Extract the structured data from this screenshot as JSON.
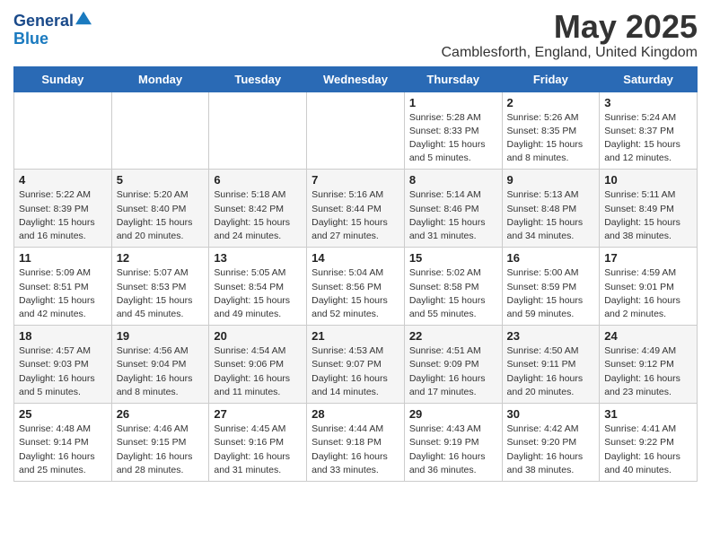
{
  "header": {
    "logo_line1": "General",
    "logo_line2": "Blue",
    "month_title": "May 2025",
    "location": "Camblesforth, England, United Kingdom"
  },
  "days_of_week": [
    "Sunday",
    "Monday",
    "Tuesday",
    "Wednesday",
    "Thursday",
    "Friday",
    "Saturday"
  ],
  "weeks": [
    [
      {
        "day": "",
        "info": ""
      },
      {
        "day": "",
        "info": ""
      },
      {
        "day": "",
        "info": ""
      },
      {
        "day": "",
        "info": ""
      },
      {
        "day": "1",
        "info": "Sunrise: 5:28 AM\nSunset: 8:33 PM\nDaylight: 15 hours\nand 5 minutes."
      },
      {
        "day": "2",
        "info": "Sunrise: 5:26 AM\nSunset: 8:35 PM\nDaylight: 15 hours\nand 8 minutes."
      },
      {
        "day": "3",
        "info": "Sunrise: 5:24 AM\nSunset: 8:37 PM\nDaylight: 15 hours\nand 12 minutes."
      }
    ],
    [
      {
        "day": "4",
        "info": "Sunrise: 5:22 AM\nSunset: 8:39 PM\nDaylight: 15 hours\nand 16 minutes."
      },
      {
        "day": "5",
        "info": "Sunrise: 5:20 AM\nSunset: 8:40 PM\nDaylight: 15 hours\nand 20 minutes."
      },
      {
        "day": "6",
        "info": "Sunrise: 5:18 AM\nSunset: 8:42 PM\nDaylight: 15 hours\nand 24 minutes."
      },
      {
        "day": "7",
        "info": "Sunrise: 5:16 AM\nSunset: 8:44 PM\nDaylight: 15 hours\nand 27 minutes."
      },
      {
        "day": "8",
        "info": "Sunrise: 5:14 AM\nSunset: 8:46 PM\nDaylight: 15 hours\nand 31 minutes."
      },
      {
        "day": "9",
        "info": "Sunrise: 5:13 AM\nSunset: 8:48 PM\nDaylight: 15 hours\nand 34 minutes."
      },
      {
        "day": "10",
        "info": "Sunrise: 5:11 AM\nSunset: 8:49 PM\nDaylight: 15 hours\nand 38 minutes."
      }
    ],
    [
      {
        "day": "11",
        "info": "Sunrise: 5:09 AM\nSunset: 8:51 PM\nDaylight: 15 hours\nand 42 minutes."
      },
      {
        "day": "12",
        "info": "Sunrise: 5:07 AM\nSunset: 8:53 PM\nDaylight: 15 hours\nand 45 minutes."
      },
      {
        "day": "13",
        "info": "Sunrise: 5:05 AM\nSunset: 8:54 PM\nDaylight: 15 hours\nand 49 minutes."
      },
      {
        "day": "14",
        "info": "Sunrise: 5:04 AM\nSunset: 8:56 PM\nDaylight: 15 hours\nand 52 minutes."
      },
      {
        "day": "15",
        "info": "Sunrise: 5:02 AM\nSunset: 8:58 PM\nDaylight: 15 hours\nand 55 minutes."
      },
      {
        "day": "16",
        "info": "Sunrise: 5:00 AM\nSunset: 8:59 PM\nDaylight: 15 hours\nand 59 minutes."
      },
      {
        "day": "17",
        "info": "Sunrise: 4:59 AM\nSunset: 9:01 PM\nDaylight: 16 hours\nand 2 minutes."
      }
    ],
    [
      {
        "day": "18",
        "info": "Sunrise: 4:57 AM\nSunset: 9:03 PM\nDaylight: 16 hours\nand 5 minutes."
      },
      {
        "day": "19",
        "info": "Sunrise: 4:56 AM\nSunset: 9:04 PM\nDaylight: 16 hours\nand 8 minutes."
      },
      {
        "day": "20",
        "info": "Sunrise: 4:54 AM\nSunset: 9:06 PM\nDaylight: 16 hours\nand 11 minutes."
      },
      {
        "day": "21",
        "info": "Sunrise: 4:53 AM\nSunset: 9:07 PM\nDaylight: 16 hours\nand 14 minutes."
      },
      {
        "day": "22",
        "info": "Sunrise: 4:51 AM\nSunset: 9:09 PM\nDaylight: 16 hours\nand 17 minutes."
      },
      {
        "day": "23",
        "info": "Sunrise: 4:50 AM\nSunset: 9:11 PM\nDaylight: 16 hours\nand 20 minutes."
      },
      {
        "day": "24",
        "info": "Sunrise: 4:49 AM\nSunset: 9:12 PM\nDaylight: 16 hours\nand 23 minutes."
      }
    ],
    [
      {
        "day": "25",
        "info": "Sunrise: 4:48 AM\nSunset: 9:14 PM\nDaylight: 16 hours\nand 25 minutes."
      },
      {
        "day": "26",
        "info": "Sunrise: 4:46 AM\nSunset: 9:15 PM\nDaylight: 16 hours\nand 28 minutes."
      },
      {
        "day": "27",
        "info": "Sunrise: 4:45 AM\nSunset: 9:16 PM\nDaylight: 16 hours\nand 31 minutes."
      },
      {
        "day": "28",
        "info": "Sunrise: 4:44 AM\nSunset: 9:18 PM\nDaylight: 16 hours\nand 33 minutes."
      },
      {
        "day": "29",
        "info": "Sunrise: 4:43 AM\nSunset: 9:19 PM\nDaylight: 16 hours\nand 36 minutes."
      },
      {
        "day": "30",
        "info": "Sunrise: 4:42 AM\nSunset: 9:20 PM\nDaylight: 16 hours\nand 38 minutes."
      },
      {
        "day": "31",
        "info": "Sunrise: 4:41 AM\nSunset: 9:22 PM\nDaylight: 16 hours\nand 40 minutes."
      }
    ]
  ]
}
